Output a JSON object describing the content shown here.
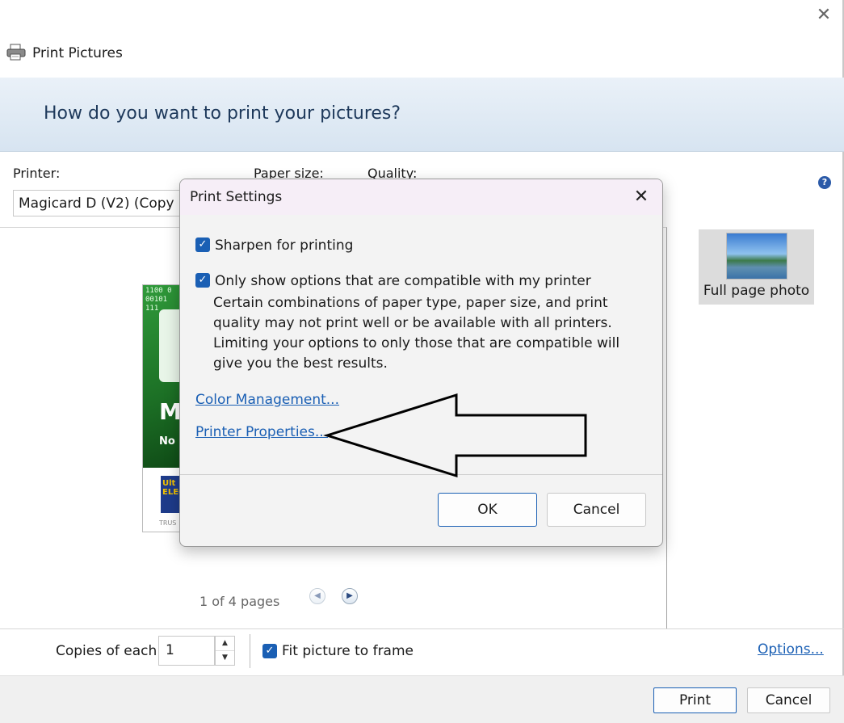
{
  "window": {
    "title": "Print Pictures",
    "close_glyph": "✕"
  },
  "banner": {
    "heading": "How do you want to print your pictures?"
  },
  "settings": {
    "printer_label": "Printer:",
    "printer_value": "Magicard D (V2) (Copy 1)",
    "paper_size_label": "Paper size:",
    "quality_label": "Quality:",
    "help_glyph": "?"
  },
  "preview": {
    "card_binary": "1100 0\n00101\n111",
    "card_letter": "M",
    "card_subtext": "No",
    "card_logo": "Ult\nELEC",
    "card_footer": "TRUS",
    "page_count": "1 of 4 pages",
    "prev_glyph": "◀",
    "next_glyph": "▶"
  },
  "layouts": {
    "selected_label": "Full page photo"
  },
  "options_row": {
    "copies_label": "Copies of each",
    "copies_value": "1",
    "spin_up": "▲",
    "spin_down": "▼",
    "fit_label": "Fit picture to frame",
    "fit_checked": true,
    "options_link": "Options..."
  },
  "footer": {
    "print_label": "Print",
    "cancel_label": "Cancel"
  },
  "dialog": {
    "title": "Print Settings",
    "close_glyph": "✕",
    "sharpen_label": "Sharpen for printing",
    "sharpen_checked": true,
    "compatible_label": "Only show options that are compatible with my printer",
    "compatible_checked": true,
    "compatible_desc": "Certain combinations of paper type, paper size, and print quality may not print well or be available with all printers.  Limiting your options to only those that are compatible will give you the best results.",
    "color_mgmt_link": "Color Management...",
    "printer_props_link": "Printer Properties...",
    "ok_label": "OK",
    "cancel_label": "Cancel",
    "check_glyph": "✓"
  },
  "colors": {
    "accent": "#1a5fb4",
    "banner_text": "#1e395b",
    "dialog_title_bg": "#f6eef7"
  }
}
